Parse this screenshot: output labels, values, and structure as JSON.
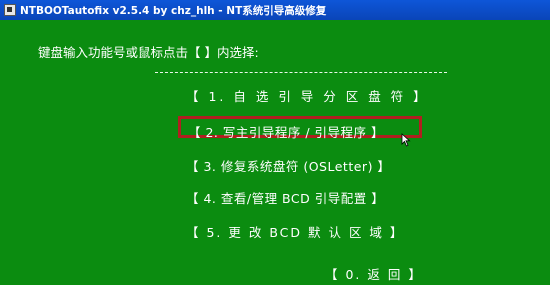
{
  "window": {
    "title": "NTBOOTautofix v2.5.4 by chz_hlh - NT系统引导高级修复"
  },
  "prompt": "键盘输入功能号或鼠标点击【 】内选择:",
  "menu": [
    {
      "label": "【 1. 自 选 引 导 分 区 盘 符 】"
    },
    {
      "label": "【 2. 写主引导程序 / 引导程序 】"
    },
    {
      "label": "【 3. 修复系统盘符 (OSLetter) 】"
    },
    {
      "label": "【 4. 查看/管理 BCD 引导配置 】"
    },
    {
      "label": "【 5. 更 改 BCD 默 认 区 域 】"
    },
    {
      "label": "【 0. 返 回 】"
    }
  ],
  "highlighted_item": "【 2. 写主引导程序 / 引导程序 】",
  "colors": {
    "background": "#0b8c10",
    "titlebar": "#0e56d8",
    "highlight": "#b02020",
    "text": "#ffffff"
  },
  "icons": {
    "app": "app-icon",
    "cursor": "mouse-cursor-icon"
  }
}
